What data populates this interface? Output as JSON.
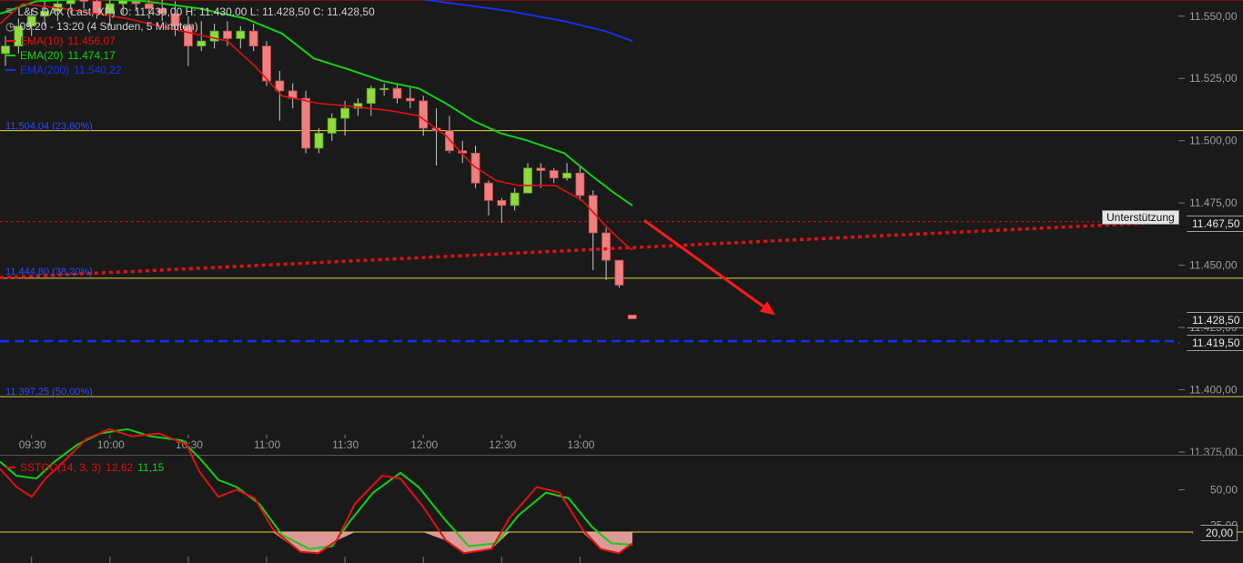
{
  "header": {
    "symbol": "L&S DAX (Last, XP)",
    "ohlc": "O: 11.430,00   H: 11.430,00   L: 11.428,50   C: 11.428,50",
    "period": "09:20 - 13:20 (4 Stunden, 5 Minuten)"
  },
  "indicators": [
    {
      "name": "EMA(10)",
      "value": "11.456,07",
      "color": "#e01010"
    },
    {
      "name": "EMA(20)",
      "value": "11.474,17",
      "color": "#12d012"
    },
    {
      "name": "EMA(200)",
      "value": "11.540,22",
      "color": "#1830e6"
    }
  ],
  "colors": {
    "background": "#1a1a1a",
    "grid": "#3a3a3a",
    "bull_candle": "#8ddc3c",
    "bear_candle": "#f08080",
    "fib_line": "#e6d23c",
    "support_line": "#e01010",
    "current_line": "#1030ff",
    "arrow": "#ff1a1a",
    "stoch_fill": "#f3a6a6"
  },
  "annotations": {
    "support_label": "Unterstützung",
    "support_price": "11.467,50",
    "last_price": "11.428,50",
    "blue_level": "11.419,50",
    "stoch_level_label": "20,00",
    "fib_levels": [
      {
        "label": "11.504,04 (23,60%)",
        "value": 11504.04
      },
      {
        "label": "11.444,80 (38,20%)",
        "value": 11444.8
      },
      {
        "label": "11.397,25 (50,00%)",
        "value": 11397.25
      }
    ]
  },
  "stoch": {
    "label": "SSTOC(14, 3, 3)",
    "k": "12,62",
    "d": "11,15",
    "level": 20
  },
  "chart_data": {
    "type": "candlestick",
    "ylim": [
      11375,
      11562
    ],
    "y_ticks": [
      "11.550,00",
      "11.525,00",
      "11.500,00",
      "11.475,00",
      "11.450,00",
      "11.425,00",
      "11.400,00",
      "11.375,00"
    ],
    "y_tick_values": [
      11550,
      11525,
      11500,
      11475,
      11450,
      11425,
      11400,
      11375
    ],
    "x_ticks": [
      "09:30",
      "10:00",
      "10:30",
      "11:00",
      "11:30",
      "12:00",
      "12:30",
      "13:00"
    ],
    "times": [
      "09:20",
      "09:25",
      "09:30",
      "09:35",
      "09:40",
      "09:45",
      "09:50",
      "09:55",
      "10:00",
      "10:05",
      "10:10",
      "10:15",
      "10:20",
      "10:25",
      "10:30",
      "10:35",
      "10:40",
      "10:45",
      "10:50",
      "10:55",
      "11:00",
      "11:05",
      "11:10",
      "11:15",
      "11:20",
      "11:25",
      "11:30",
      "11:35",
      "11:40",
      "11:45",
      "11:50",
      "11:55",
      "12:00",
      "12:05",
      "12:10",
      "12:15",
      "12:20",
      "12:25",
      "12:30",
      "12:35",
      "12:40",
      "12:45",
      "12:50",
      "12:55",
      "13:00",
      "13:05",
      "13:10",
      "13:15",
      "13:20"
    ],
    "ohlc": [
      [
        11535,
        11542,
        11530,
        11538
      ],
      [
        11538,
        11549,
        11535,
        11546
      ],
      [
        11546,
        11553,
        11542,
        11550
      ],
      [
        11550,
        11556,
        11546,
        11552
      ],
      [
        11552,
        11558,
        11548,
        11555
      ],
      [
        11555,
        11562,
        11551,
        11559
      ],
      [
        11559,
        11562,
        11553,
        11556
      ],
      [
        11556,
        11560,
        11549,
        11551
      ],
      [
        11551,
        11558,
        11546,
        11555
      ],
      [
        11555,
        11562,
        11551,
        11558
      ],
      [
        11558,
        11562,
        11552,
        11555
      ],
      [
        11555,
        11561,
        11549,
        11553
      ],
      [
        11553,
        11559,
        11548,
        11551
      ],
      [
        11551,
        11556,
        11542,
        11546
      ],
      [
        11546,
        11550,
        11530,
        11538
      ],
      [
        11538,
        11548,
        11536,
        11540
      ],
      [
        11540,
        11547,
        11537,
        11544
      ],
      [
        11544,
        11548,
        11538,
        11541
      ],
      [
        11541,
        11546,
        11537,
        11544
      ],
      [
        11544,
        11547,
        11536,
        11538
      ],
      [
        11538,
        11540,
        11522,
        11524
      ],
      [
        11524,
        11528,
        11508,
        11520
      ],
      [
        11520,
        11523,
        11513,
        11517
      ],
      [
        11517,
        11520,
        11495,
        11497
      ],
      [
        11497,
        11505,
        11495,
        11503
      ],
      [
        11503,
        11511,
        11500,
        11509
      ],
      [
        11509,
        11516,
        11502,
        11513
      ],
      [
        11513,
        11517,
        11510,
        11515
      ],
      [
        11515,
        11522,
        11510,
        11521
      ],
      [
        11521,
        11523,
        11518,
        11521
      ],
      [
        11521,
        11523,
        11515,
        11517
      ],
      [
        11517,
        11522,
        11513,
        11516
      ],
      [
        11516,
        11518,
        11502,
        11505
      ],
      [
        11505,
        11513,
        11490,
        11504
      ],
      [
        11504,
        11510,
        11495,
        11496
      ],
      [
        11496,
        11500,
        11491,
        11495
      ],
      [
        11495,
        11498,
        11481,
        11483
      ],
      [
        11483,
        11484,
        11470,
        11476
      ],
      [
        11476,
        11477,
        11467,
        11474
      ],
      [
        11474,
        11481,
        11472,
        11479
      ],
      [
        11479,
        11491,
        11479,
        11489
      ],
      [
        11489,
        11491,
        11481,
        11488
      ],
      [
        11488,
        11489,
        11483,
        11485
      ],
      [
        11485,
        11491,
        11484,
        11487
      ],
      [
        11487,
        11490,
        11476,
        11478
      ],
      [
        11478,
        11480,
        11448,
        11463
      ],
      [
        11463,
        11465,
        11444,
        11452
      ],
      [
        11452,
        11452,
        11441,
        11442
      ],
      [
        11430,
        11430,
        11428.5,
        11428.5
      ]
    ],
    "ema10": [
      [
        0,
        11547
      ],
      [
        25,
        11555
      ],
      [
        70,
        11553
      ],
      [
        140,
        11549
      ],
      [
        200,
        11544
      ],
      [
        250,
        11540
      ],
      [
        280,
        11530
      ],
      [
        310,
        11518
      ],
      [
        350,
        11515
      ],
      [
        380,
        11514
      ],
      [
        430,
        11512
      ],
      [
        460,
        11510
      ],
      [
        490,
        11502
      ],
      [
        520,
        11490
      ],
      [
        545,
        11484
      ],
      [
        570,
        11482
      ],
      [
        610,
        11482
      ],
      [
        640,
        11476
      ],
      [
        665,
        11466
      ],
      [
        685,
        11459
      ],
      [
        695,
        11456
      ]
    ],
    "ema20": [
      [
        0,
        11551
      ],
      [
        40,
        11556
      ],
      [
        100,
        11557
      ],
      [
        160,
        11556
      ],
      [
        220,
        11553
      ],
      [
        270,
        11549
      ],
      [
        310,
        11543
      ],
      [
        345,
        11533
      ],
      [
        380,
        11529
      ],
      [
        420,
        11524
      ],
      [
        460,
        11521
      ],
      [
        490,
        11515
      ],
      [
        520,
        11508
      ],
      [
        550,
        11503
      ],
      [
        580,
        11500
      ],
      [
        620,
        11495
      ],
      [
        650,
        11486
      ],
      [
        675,
        11479
      ],
      [
        695,
        11474
      ]
    ],
    "ema200": [
      [
        0,
        11566
      ],
      [
        200,
        11564
      ],
      [
        360,
        11562
      ],
      [
        480,
        11556
      ],
      [
        560,
        11552
      ],
      [
        620,
        11548
      ],
      [
        665,
        11544
      ],
      [
        695,
        11540
      ]
    ],
    "support_line": {
      "x_from": 0,
      "x_to": 1295,
      "y_from": 11445,
      "y_to": 11467.5
    },
    "blue_level": 11419.5,
    "arrow": {
      "from": [
        708,
        11468
      ],
      "to": [
        852,
        11430
      ]
    },
    "stoch_k": [
      [
        0,
        65
      ],
      [
        18,
        52
      ],
      [
        35,
        45
      ],
      [
        50,
        58
      ],
      [
        70,
        70
      ],
      [
        95,
        86
      ],
      [
        120,
        93
      ],
      [
        145,
        88
      ],
      [
        175,
        90
      ],
      [
        205,
        82
      ],
      [
        220,
        62
      ],
      [
        240,
        45
      ],
      [
        260,
        50
      ],
      [
        280,
        44
      ],
      [
        300,
        22
      ],
      [
        330,
        6
      ],
      [
        350,
        5
      ],
      [
        370,
        14
      ],
      [
        390,
        40
      ],
      [
        420,
        60
      ],
      [
        440,
        58
      ],
      [
        465,
        38
      ],
      [
        490,
        14
      ],
      [
        510,
        5
      ],
      [
        540,
        8
      ],
      [
        560,
        30
      ],
      [
        590,
        52
      ],
      [
        615,
        48
      ],
      [
        640,
        22
      ],
      [
        660,
        8
      ],
      [
        680,
        5
      ],
      [
        695,
        12
      ]
    ],
    "stoch_d": [
      [
        0,
        70
      ],
      [
        18,
        60
      ],
      [
        40,
        58
      ],
      [
        60,
        70
      ],
      [
        85,
        82
      ],
      [
        110,
        90
      ],
      [
        140,
        93
      ],
      [
        165,
        88
      ],
      [
        200,
        85
      ],
      [
        220,
        72
      ],
      [
        240,
        57
      ],
      [
        260,
        52
      ],
      [
        285,
        40
      ],
      [
        310,
        18
      ],
      [
        340,
        8
      ],
      [
        365,
        10
      ],
      [
        385,
        28
      ],
      [
        410,
        48
      ],
      [
        440,
        62
      ],
      [
        460,
        52
      ],
      [
        490,
        28
      ],
      [
        515,
        10
      ],
      [
        545,
        12
      ],
      [
        570,
        32
      ],
      [
        600,
        48
      ],
      [
        625,
        44
      ],
      [
        650,
        24
      ],
      [
        672,
        12
      ],
      [
        695,
        11
      ]
    ]
  }
}
